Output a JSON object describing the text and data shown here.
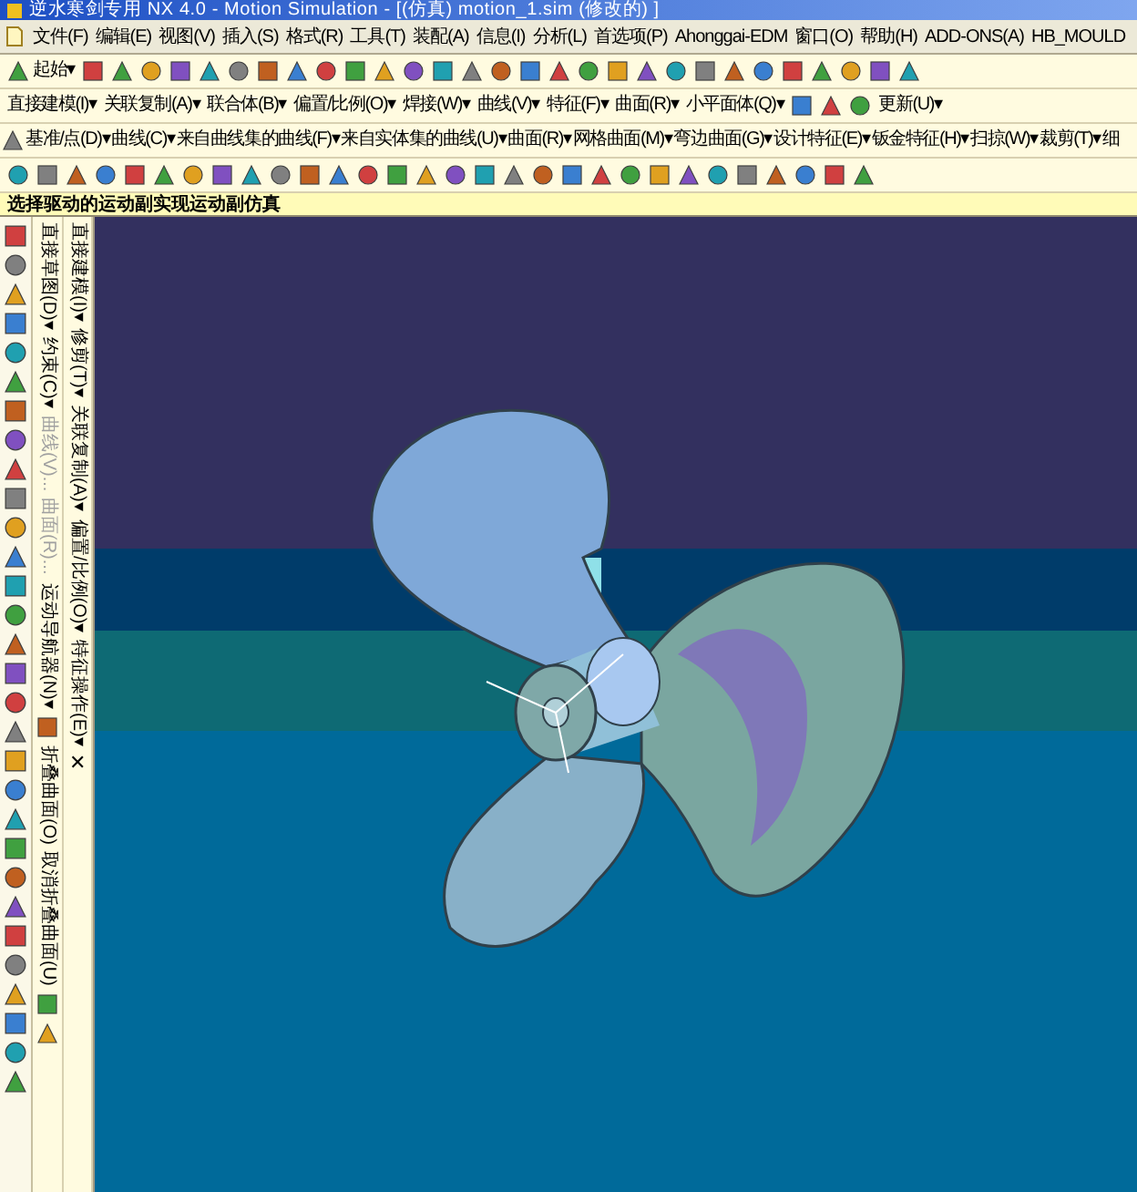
{
  "window": {
    "title": "逆水寒剑专用 NX 4.0 - Motion Simulation - [(仿真) motion_1.sim (修改的) ]"
  },
  "menu_bar": [
    "文件(F)",
    "编辑(E)",
    "视图(V)",
    "插入(S)",
    "格式(R)",
    "工具(T)",
    "装配(A)",
    "信息(I)",
    "分析(L)",
    "首选项(P)",
    "Ahonggai-EDM",
    "窗口(O)",
    "帮助(H)",
    "ADD-ONS(A)",
    "HB_MOULD"
  ],
  "toolbars": [
    {
      "items": [
        {
          "kind": "start",
          "label": "起始▾"
        },
        {
          "kind": "icon"
        },
        {
          "kind": "icon"
        },
        {
          "kind": "icon"
        },
        {
          "kind": "icon"
        },
        {
          "kind": "icon"
        },
        {
          "kind": "icon"
        },
        {
          "kind": "icon"
        },
        {
          "kind": "icon"
        },
        {
          "kind": "icon"
        },
        {
          "kind": "icon"
        },
        {
          "kind": "icon"
        },
        {
          "kind": "icon"
        },
        {
          "kind": "icon"
        },
        {
          "kind": "icon"
        },
        {
          "kind": "icon"
        },
        {
          "kind": "icon"
        },
        {
          "kind": "icon"
        },
        {
          "kind": "icon"
        },
        {
          "kind": "icon"
        },
        {
          "kind": "icon"
        },
        {
          "kind": "icon"
        },
        {
          "kind": "icon"
        },
        {
          "kind": "icon"
        },
        {
          "kind": "icon"
        },
        {
          "kind": "icon"
        },
        {
          "kind": "icon"
        },
        {
          "kind": "icon"
        },
        {
          "kind": "icon"
        },
        {
          "kind": "icon"
        }
      ]
    },
    {
      "items": [
        {
          "kind": "menu",
          "label": "直接建模(I)▾"
        },
        {
          "kind": "menu",
          "label": "关联复制(A)▾"
        },
        {
          "kind": "menu",
          "label": "联合体(B)▾"
        },
        {
          "kind": "menu",
          "label": "偏置/比例(O)▾"
        },
        {
          "kind": "menu",
          "label": "焊接(W)▾"
        },
        {
          "kind": "menu",
          "label": "曲线(V)▾"
        },
        {
          "kind": "menu",
          "label": "特征(F)▾"
        },
        {
          "kind": "menu",
          "label": "曲面(R)▾"
        },
        {
          "kind": "menu",
          "label": "小平面体(Q)▾"
        },
        {
          "kind": "icon"
        },
        {
          "kind": "icon"
        },
        {
          "kind": "icon"
        },
        {
          "kind": "menu",
          "label": "更新(U)▾"
        }
      ]
    },
    {
      "items": [
        {
          "kind": "icon"
        },
        {
          "kind": "menu",
          "label": "基准/点(D)▾"
        },
        {
          "kind": "menu",
          "label": "曲线(C)▾"
        },
        {
          "kind": "menu",
          "label": "来自曲线集的曲线(F)▾"
        },
        {
          "kind": "menu",
          "label": "来自实体集的曲线(U)▾"
        },
        {
          "kind": "menu",
          "label": "曲面(R)▾"
        },
        {
          "kind": "menu",
          "label": "网格曲面(M)▾"
        },
        {
          "kind": "menu",
          "label": "弯边曲面(G)▾"
        },
        {
          "kind": "menu",
          "label": "设计特征(E)▾"
        },
        {
          "kind": "menu",
          "label": "钣金特征(H)▾"
        },
        {
          "kind": "menu",
          "label": "扫掠(W)▾"
        },
        {
          "kind": "menu",
          "label": "裁剪(T)▾"
        },
        {
          "kind": "menu",
          "label": "细"
        }
      ]
    },
    {
      "items": [
        {
          "kind": "icon"
        },
        {
          "kind": "icon"
        },
        {
          "kind": "icon"
        },
        {
          "kind": "icon"
        },
        {
          "kind": "icon"
        },
        {
          "kind": "icon"
        },
        {
          "kind": "icon"
        },
        {
          "kind": "icon"
        },
        {
          "kind": "icon"
        },
        {
          "kind": "icon"
        },
        {
          "kind": "icon"
        },
        {
          "kind": "icon"
        },
        {
          "kind": "icon"
        },
        {
          "kind": "icon"
        },
        {
          "kind": "icon"
        },
        {
          "kind": "icon"
        },
        {
          "kind": "icon"
        },
        {
          "kind": "icon"
        },
        {
          "kind": "icon"
        },
        {
          "kind": "icon"
        },
        {
          "kind": "icon"
        },
        {
          "kind": "icon"
        },
        {
          "kind": "icon"
        },
        {
          "kind": "icon"
        },
        {
          "kind": "icon"
        },
        {
          "kind": "icon"
        },
        {
          "kind": "icon"
        },
        {
          "kind": "icon"
        },
        {
          "kind": "icon"
        },
        {
          "kind": "icon"
        }
      ]
    }
  ],
  "prompt": "选择驱动的运动副实现运动副仿真",
  "vertical_toolbars": [
    {
      "items": [
        {
          "kind": "menu",
          "label": "直接草图(D)▾",
          "disabled": false
        },
        {
          "kind": "menu",
          "label": "约束(C)▾",
          "disabled": false
        },
        {
          "kind": "menu",
          "label": "曲线(V)...",
          "disabled": true
        },
        {
          "kind": "menu",
          "label": "曲面(R)...",
          "disabled": true
        },
        {
          "kind": "menu",
          "label": "运动导航器(N)▾",
          "disabled": false
        },
        {
          "kind": "icon"
        },
        {
          "kind": "menu",
          "label": "折叠曲面(O)",
          "disabled": false
        },
        {
          "kind": "menu",
          "label": "取消折叠曲面(U)",
          "disabled": false
        },
        {
          "kind": "icon"
        },
        {
          "kind": "icon"
        }
      ]
    },
    {
      "items": [
        {
          "kind": "menu",
          "label": "直接建模(I)▾",
          "disabled": false
        },
        {
          "kind": "menu",
          "label": "修剪(T)▾",
          "disabled": false
        },
        {
          "kind": "menu",
          "label": "关联复制(A)▾",
          "disabled": false
        },
        {
          "kind": "menu",
          "label": "偏置/比例(O)▾",
          "disabled": false
        },
        {
          "kind": "menu",
          "label": "特征操作(E)▾",
          "disabled": false
        },
        {
          "kind": "close",
          "label": "✕"
        }
      ]
    }
  ]
}
